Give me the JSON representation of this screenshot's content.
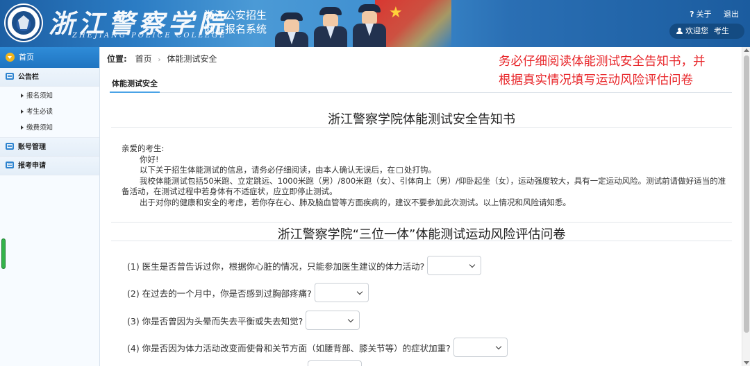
{
  "header": {
    "college_cn": "浙江警察学院",
    "college_en": "ZHEJIANG POLICE COLLEGE",
    "system_title_line1": "浙江公安招生",
    "system_title_line2": "网上报名系统",
    "about": "关于",
    "logout": "退出",
    "welcome": "欢迎您",
    "user_name": "考生"
  },
  "sidebar": {
    "home": "首页",
    "sections": [
      {
        "label": "公告栏",
        "items": [
          "报名须知",
          "考生必读",
          "缴费须知"
        ]
      },
      {
        "label": "账号管理"
      },
      {
        "label": "报考申请"
      }
    ]
  },
  "breadcrumb": {
    "label": "位置:",
    "items": [
      "首页",
      "体能测试安全"
    ]
  },
  "notice": {
    "line1": "务必仔细阅读体能测试安全告知书，并",
    "line2": "根据真实情况填写运动风险评估问卷"
  },
  "tab": {
    "label": "体能测试安全"
  },
  "letter": {
    "title": "浙江警察学院体能测试安全告知书",
    "salutation": "亲爱的考生:",
    "greeting": "你好!",
    "p1_before": "以下关于招生体能测试的信息，请务必仔细阅读，由本人确认无误后，在",
    "p1_after": "处打钩。",
    "p2": "我校体能测试包括50米跑、立定跳远、1000米跑（男）/800米跑（女）、引体向上（男）/仰卧起坐（女），运动强度较大，具有一定运动风险。测试前请做好适当的准备活动，在测试过程中若身体有不适症状，应立即停止测试。",
    "p3": "出于对你的健康和安全的考虑，若你存在心、肺及脑血管等方面疾病的，建议不要参加此次测试。以上情况和风险请知悉。"
  },
  "questionnaire": {
    "title": "浙江警察学院“三位一体”体能测试运动风险评估问卷",
    "questions": [
      "(1) 医生是否曾告诉过你，根据你心脏的情况，只能参加医生建议的体力活动?",
      "(2) 在过去的一个月中，你是否感到过胸部疼痛?",
      "(3) 你是否曾因为头晕而失去平衡或失去知觉?",
      "(4) 你是否因为体力活动改变而使骨和关节方面（如腰背部、膝关节等）的症状加重?"
    ]
  }
}
